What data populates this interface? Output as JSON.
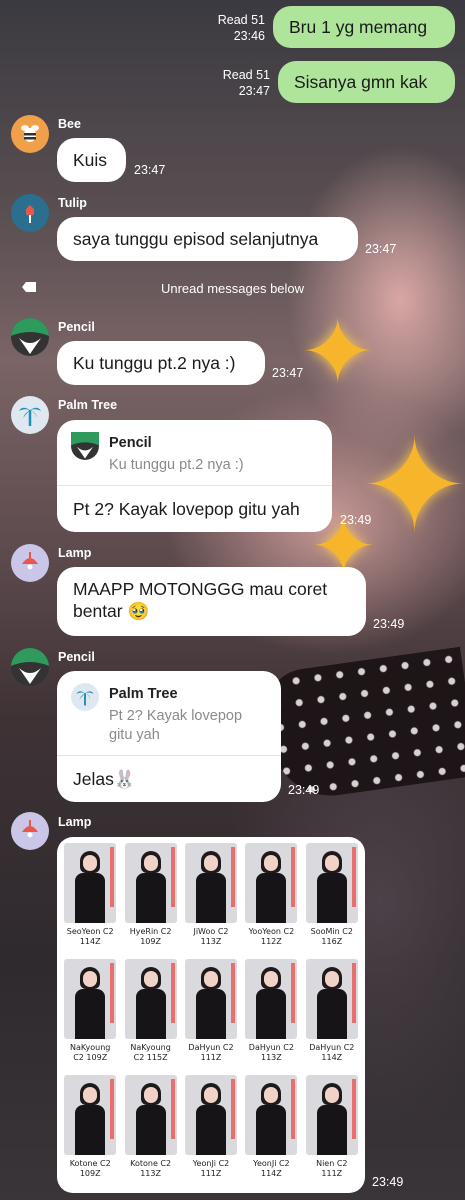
{
  "messages": [
    {
      "type": "mine",
      "text": "Bru 1 yg memang",
      "read": "Read 51",
      "time": "23:46"
    },
    {
      "type": "mine",
      "text": "Sisanya gmn kak",
      "read": "Read 51",
      "time": "23:47"
    },
    {
      "type": "other",
      "sender": "Bee",
      "text": "Kuis",
      "time": "23:47",
      "avatar": "bee-icon"
    },
    {
      "type": "other",
      "sender": "Tulip",
      "text": "saya tunggu episod selanjutnya",
      "time": "23:47",
      "avatar": "tulip-icon"
    },
    {
      "type": "other",
      "sender": "Pencil",
      "text": "Ku tunggu pt.2 nya :)",
      "time": "23:47",
      "avatar": "pencil-icon"
    },
    {
      "type": "reply",
      "sender": "Palm Tree",
      "reply_to": "Pencil",
      "reply_text": "Ku tunggu pt.2 nya :)",
      "text": "Pt 2? Kayak lovepop gitu yah",
      "time": "23:49",
      "avatar": "palm-tree-icon"
    },
    {
      "type": "other",
      "sender": "Lamp",
      "text": "MAAPP MOTONGGG mau coret bentar",
      "emoji": "🥹",
      "time": "23:49",
      "avatar": "lamp-icon"
    },
    {
      "type": "reply",
      "sender": "Pencil",
      "reply_to": "Palm Tree",
      "reply_text": "Pt 2? Kayak lovepop gitu yah",
      "text": "Jelas",
      "emoji": "🐰",
      "time": "23:49",
      "avatar": "pencil-icon"
    },
    {
      "type": "image",
      "sender": "Lamp",
      "time": "23:49",
      "avatar": "lamp-icon"
    }
  ],
  "unread_divider": "Unread messages below",
  "photocards": [
    {
      "name": "SeoYeon C2",
      "price": "114Z"
    },
    {
      "name": "HyeRin C2",
      "price": "109Z"
    },
    {
      "name": "JiWoo C2",
      "price": "113Z"
    },
    {
      "name": "YooYeon C2",
      "price": "112Z"
    },
    {
      "name": "SooMin C2",
      "price": "116Z"
    },
    {
      "name": "NaKyoung",
      "price": "C2 109Z"
    },
    {
      "name": "NaKyoung",
      "price": "C2 115Z"
    },
    {
      "name": "DaHyun C2",
      "price": "111Z"
    },
    {
      "name": "DaHyun C2",
      "price": "113Z"
    },
    {
      "name": "DaHyun C2",
      "price": "114Z"
    },
    {
      "name": "Kotone C2",
      "price": "109Z"
    },
    {
      "name": "Kotone C2",
      "price": "113Z"
    },
    {
      "name": "YeonJi C2",
      "price": "111Z"
    },
    {
      "name": "YeonJi C2",
      "price": "114Z"
    },
    {
      "name": "Nien C2",
      "price": "111Z"
    }
  ],
  "colors": {
    "mine_bubble": "#aee59b",
    "other_bubble": "#ffffff",
    "bee": "#f0a04b",
    "tulip": "#2a6f8f",
    "pencil": "#3a3a3a",
    "palm": "#dfe8f0",
    "lamp": "#c9c6e8"
  }
}
